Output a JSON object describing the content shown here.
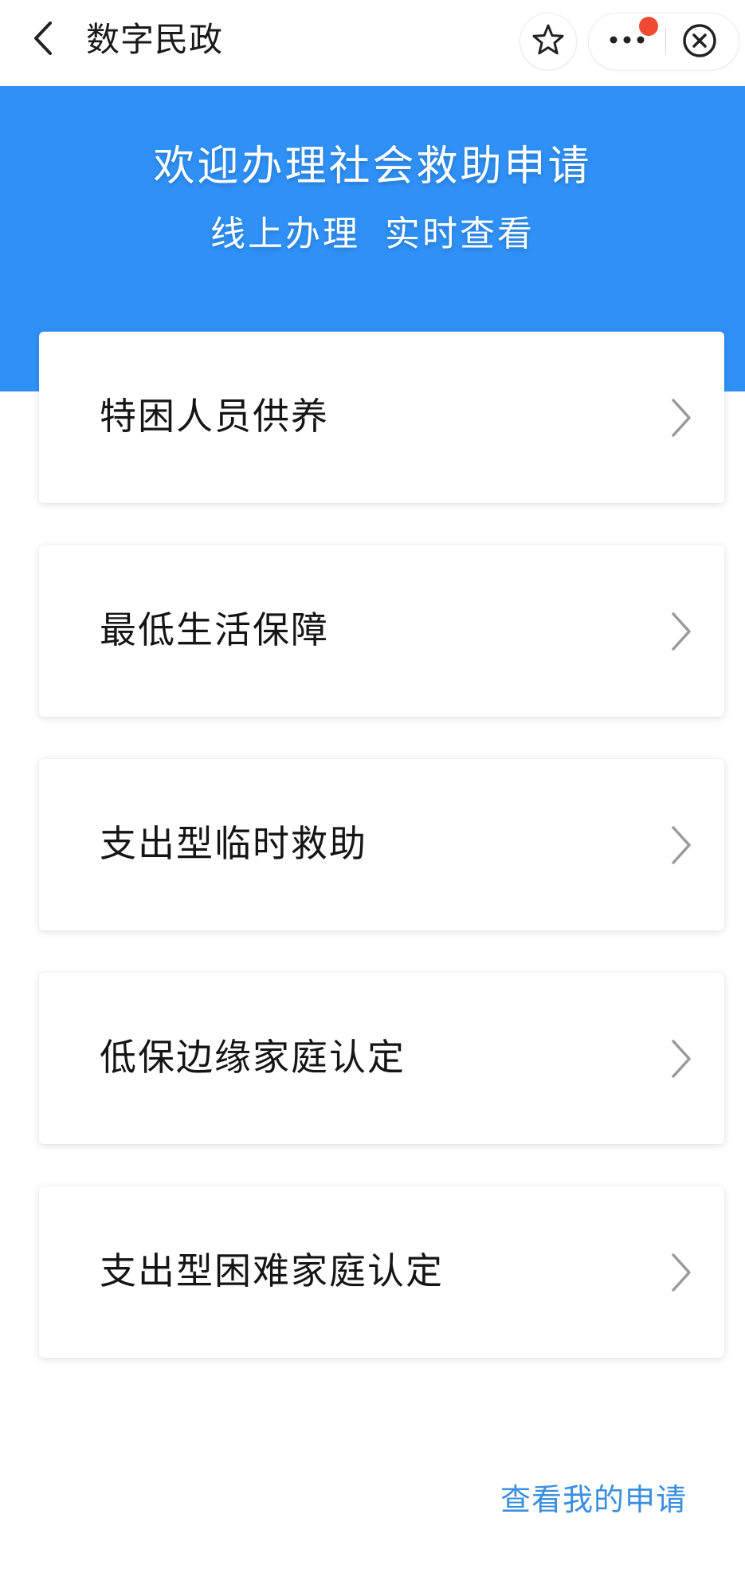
{
  "nav": {
    "title": "数字民政",
    "icons": {
      "back": "chevron-left-icon",
      "star": "star-icon",
      "more": "more-horizontal-icon",
      "close": "close-circle-icon"
    },
    "notification_dot_color": "#f04a32"
  },
  "banner": {
    "title": "欢迎办理社会救助申请",
    "subtitle": "线上办理 实时查看",
    "background_color": "#2f91f7"
  },
  "services": [
    {
      "label": "特困人员供养"
    },
    {
      "label": "最低生活保障"
    },
    {
      "label": "支出型临时救助"
    },
    {
      "label": "低保边缘家庭认定"
    },
    {
      "label": "支出型困难家庭认定"
    }
  ],
  "footer": {
    "my_applications_link": "查看我的申请",
    "link_color": "#3a8fe0"
  }
}
